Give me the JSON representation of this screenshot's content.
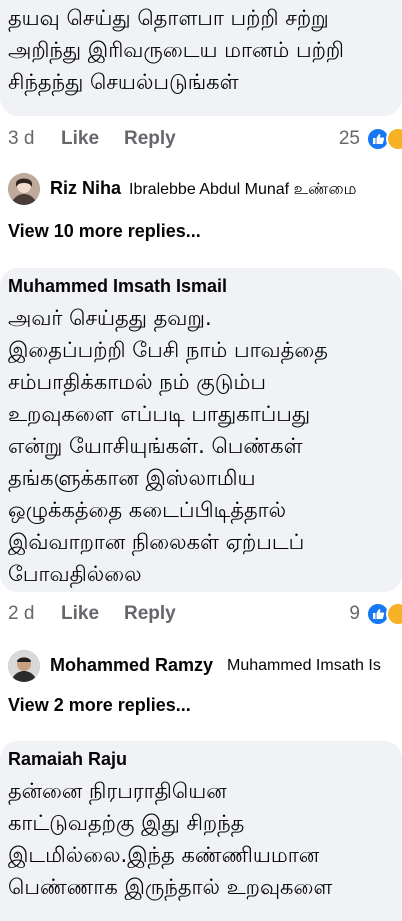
{
  "comment1": {
    "text": "தயவு செய்து தொளபா பற்றி சற்று\nஅறிந்து இரிவருடைய மானம் பற்றி\nசிந்தந்து செயல்படுங்கள்",
    "time": "3 d",
    "like_label": "Like",
    "reply_label": "Reply",
    "reaction_count": "25",
    "reply_preview": {
      "author": "Riz Niha",
      "text": "Ibralebbe Abdul Munaf உண்மை"
    },
    "view_more": "View 10 more replies..."
  },
  "comment2": {
    "author": "Muhammed Imsath Ismail",
    "text": "அவர் செய்தது தவறு.\nஇதைப்பற்றி பேசி நாம் பாவத்தை\nசம்பாதிக்காமல் நம் குடும்ப\nஉறவுகளை எப்படி பாதுகாப்பது\nஎன்று யோசியுங்கள். பெண்கள்\nதங்களுக்கான இஸ்லாமிய\nஒழுக்கத்தை கடைப்பிடித்தால்\nஇவ்வாறான நிலைகள் ஏற்படப்\nபோவதில்லை",
    "time": "2 d",
    "like_label": "Like",
    "reply_label": "Reply",
    "reaction_count": "9",
    "reply_preview": {
      "author": "Mohammed Ramzy",
      "text": "Muhammed Imsath Is"
    },
    "view_more": "View 2 more replies..."
  },
  "comment3": {
    "author": "Ramaiah Raju",
    "text": "தன்னை நிரபராதியென\nகாட்டுவதற்கு இது சிறந்த\nஇடமில்லை.இந்த கண்ணியமான\nபெண்ணாக இருந்தால் உறவுகளை"
  },
  "icons": {
    "like_reaction": "like-reaction-icon",
    "haha_reaction": "haha-reaction-icon"
  },
  "colors": {
    "bubble": "#f0f2f5",
    "secondary_text": "#65676b",
    "like_blue": "#1877f2",
    "haha_yellow": "#f7b125"
  }
}
